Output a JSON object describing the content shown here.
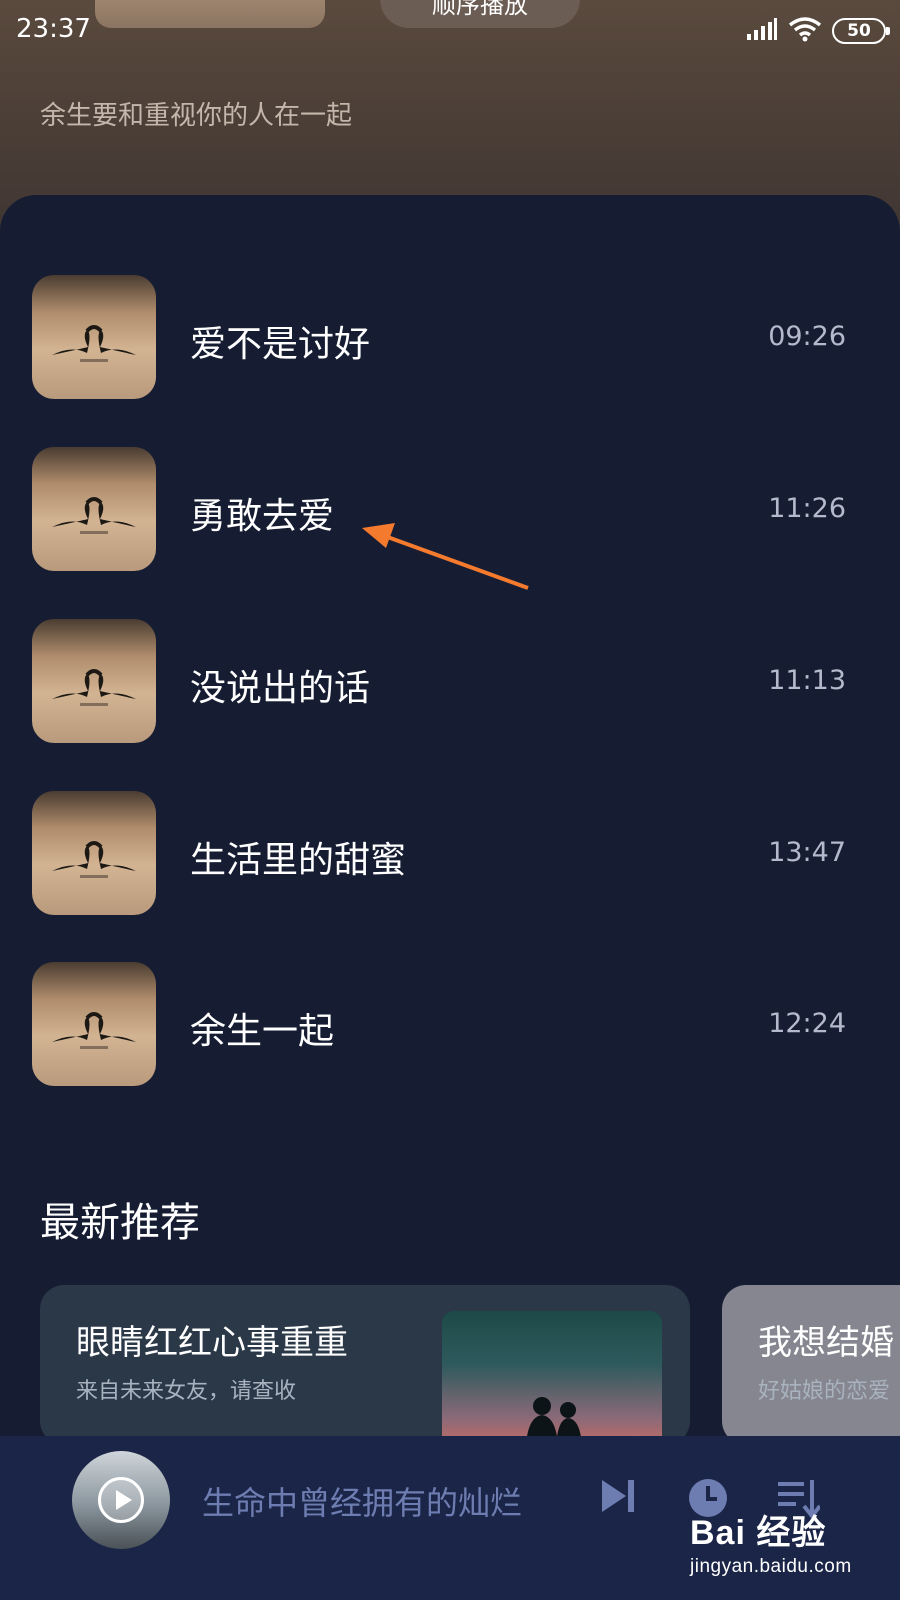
{
  "status_bar": {
    "time": "23:37",
    "battery": "50",
    "icons": [
      "signal-icon",
      "wifi-icon",
      "battery-icon"
    ]
  },
  "header": {
    "play_order_label": "顺序播放",
    "subtitle": "余生要和重视你的人在一起"
  },
  "tracks": [
    {
      "title": "爱不是讨好",
      "duration": "09:26"
    },
    {
      "title": "勇敢去爱",
      "duration": "11:26"
    },
    {
      "title": "没说出的话",
      "duration": "11:13"
    },
    {
      "title": "生活里的甜蜜",
      "duration": "13:47"
    },
    {
      "title": "余生一起",
      "duration": "12:24"
    }
  ],
  "recommend": {
    "section_title": "最新推荐",
    "cards": [
      {
        "title": "眼睛红红心事重重",
        "subtitle": "来自未来女友，请查收"
      },
      {
        "title": "我想结婚",
        "subtitle": "好姑娘的恋爱"
      }
    ]
  },
  "player": {
    "now_playing": "生命中曾经拥有的灿烂",
    "icons": [
      "play-icon",
      "next-icon",
      "timer-icon",
      "playlist-icon"
    ]
  },
  "watermark": {
    "brand": "Bai 经验",
    "url": "jingyan.baidu.com"
  },
  "colors": {
    "panel_bg": "#161d33",
    "player_bg": "#1b2547",
    "annotation_arrow": "#f47a2e",
    "player_accent": "#6e7db1"
  }
}
